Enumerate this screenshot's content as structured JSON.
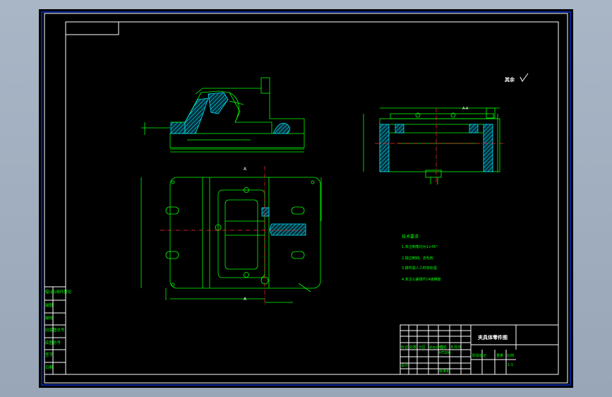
{
  "drawing_title": "夹具体零件图",
  "roughness_note": "其余",
  "tech_requirements": {
    "heading": "技术要求",
    "items": [
      "1.未注倒角均为1×45°",
      "2.锐边倒钝，去毛刺",
      "3.铸件需人工时效处理",
      "4.未注公差按IT14级精度"
    ]
  },
  "section_labels": {
    "top": "A",
    "bottom": "A",
    "left_view": "A-A"
  },
  "left_stamp_rows": [
    "借(通)用件登记",
    "描图",
    "描校",
    "旧底图总号",
    "底图总号",
    "签字",
    "日期"
  ],
  "title_block": {
    "scale": "1:1",
    "material": "HT200",
    "header_cells": [
      "标记",
      "处数",
      "分区",
      "更改文件号",
      "签名",
      "年月日"
    ],
    "stage_cells": [
      "阶段标记",
      "重量",
      "比例"
    ],
    "sign_cells": [
      "设计",
      "标准化"
    ]
  },
  "colors": {
    "frame": "#ffffff",
    "outline": "#00ff00",
    "hatch": "#00e5ff",
    "center": "#ff2a2a",
    "background": "#000000"
  }
}
